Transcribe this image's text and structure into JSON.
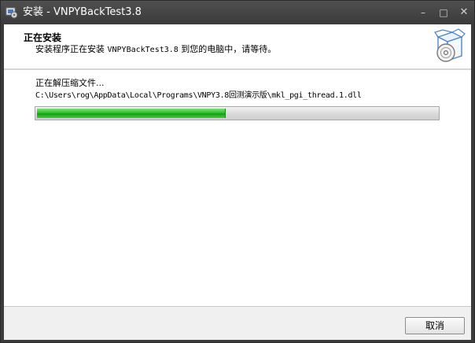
{
  "window": {
    "title": "安装 - VNPYBackTest3.8",
    "controls": {
      "minimize": "–",
      "maximize": "□",
      "close": "✕"
    }
  },
  "header": {
    "title": "正在安装",
    "subtitle_prefix": "安装程序正在安装 ",
    "subtitle_app": "VNPYBackTest3.8",
    "subtitle_suffix": " 到您的电脑中，请等待。",
    "icon": "install-box-disc-icon"
  },
  "content": {
    "status": "正在解压缩文件...",
    "file_path": "C:\\Users\\rog\\AppData\\Local\\Programs\\VNPY3.8回测演示版\\mkl_pgi_thread.1.dll",
    "progress": 0.47
  },
  "footer": {
    "cancel_label": "取消"
  },
  "colors": {
    "titlebar": "#3c3c3c",
    "progress_fill": "#2fc02f"
  }
}
